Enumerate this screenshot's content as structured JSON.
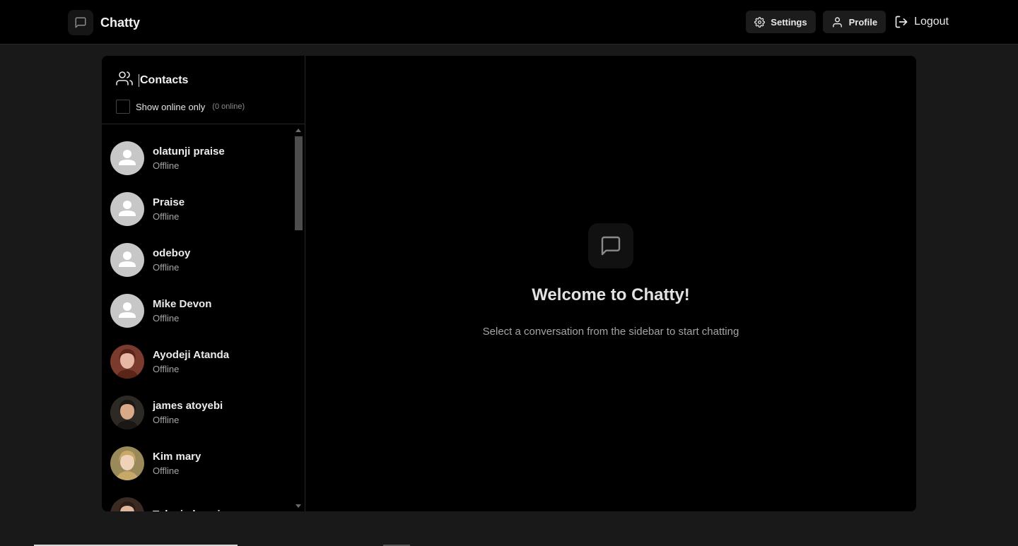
{
  "app": {
    "name": "Chatty"
  },
  "nav": {
    "settings_label": "Settings",
    "profile_label": "Profile",
    "logout_label": "Logout"
  },
  "sidebar": {
    "title": "Contacts",
    "filter_label": "Show online only",
    "online_count": "(0 online)",
    "contacts": [
      {
        "name": "olatunji praise",
        "status": "Offline",
        "avatar": "placeholder"
      },
      {
        "name": "Praise",
        "status": "Offline",
        "avatar": "placeholder"
      },
      {
        "name": "odeboy",
        "status": "Offline",
        "avatar": "placeholder"
      },
      {
        "name": "Mike Devon",
        "status": "Offline",
        "avatar": "placeholder"
      },
      {
        "name": "Ayodeji Atanda",
        "status": "Offline",
        "avatar": "photo"
      },
      {
        "name": "james atoyebi",
        "status": "Offline",
        "avatar": "photo"
      },
      {
        "name": "Kim mary",
        "status": "Offline",
        "avatar": "photo"
      },
      {
        "name": "Tolani okoosi",
        "status": "",
        "avatar": "photo"
      }
    ]
  },
  "welcome": {
    "title": "Welcome to Chatty!",
    "subtitle": "Select a conversation from the sidebar to start chatting"
  },
  "colors": {
    "background": "#191919",
    "panel": "#000000",
    "muted_text": "#a4a4a4"
  },
  "icons": {
    "brand": "message-square-icon",
    "settings": "gear-icon",
    "profile": "user-icon",
    "logout": "logout-icon",
    "contacts": "users-icon"
  }
}
